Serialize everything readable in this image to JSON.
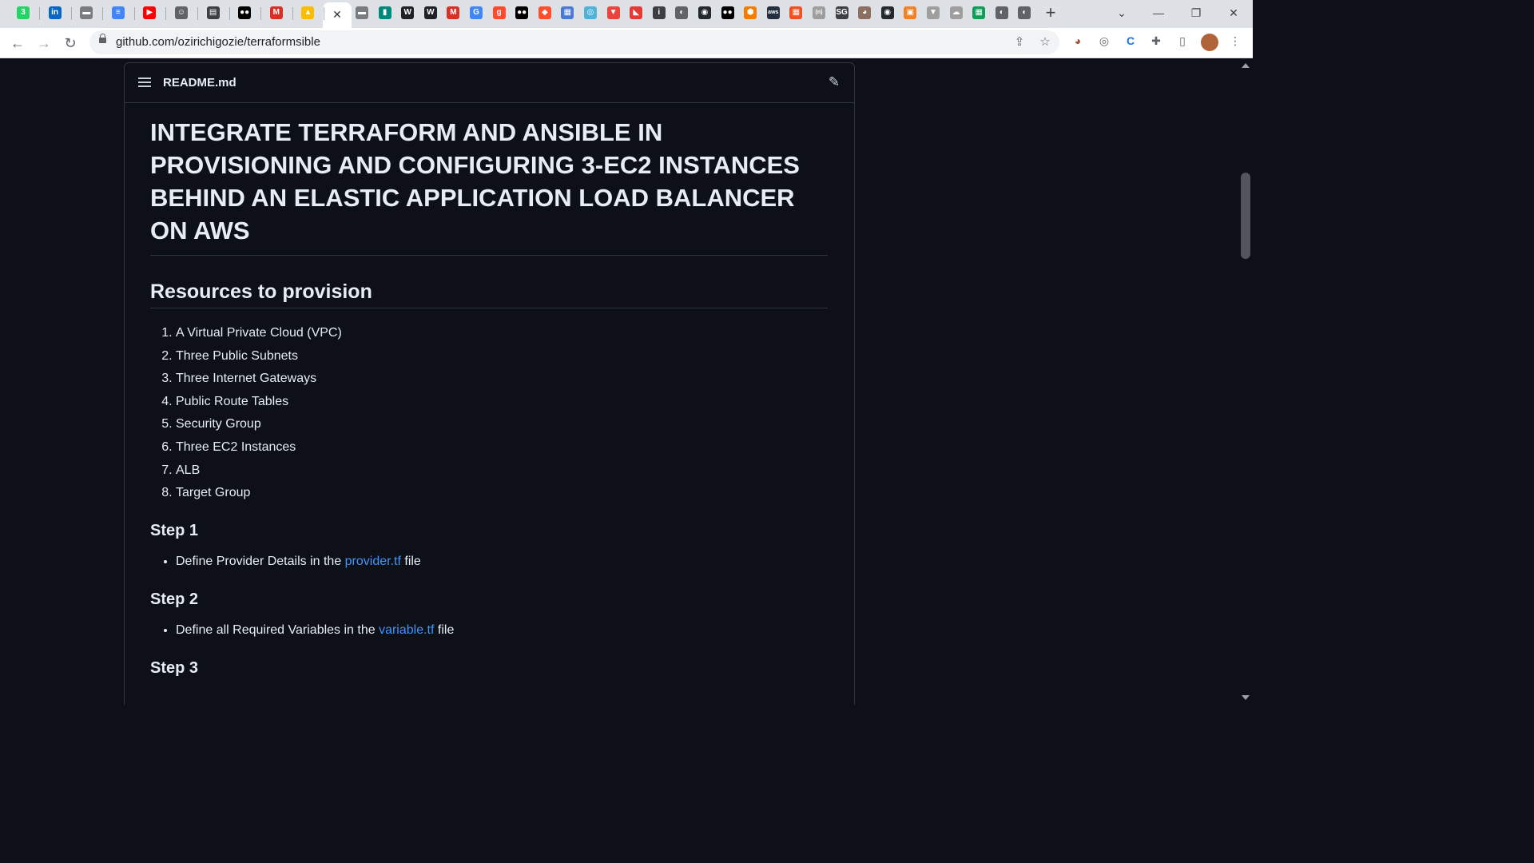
{
  "browser": {
    "tabs": [
      {
        "icon": "whatsapp-icon",
        "glyph": "3",
        "color": "#25d366"
      },
      {
        "icon": "linkedin-icon",
        "glyph": "in",
        "color": "#0a66c2"
      },
      {
        "icon": "folder-icon",
        "glyph": "▬",
        "color": "#7a7d80"
      },
      {
        "icon": "docs-icon",
        "glyph": "≡",
        "color": "#4285f4"
      },
      {
        "icon": "youtube-icon",
        "glyph": "▶",
        "color": "#ff0000"
      },
      {
        "icon": "smiley-icon",
        "glyph": "☺",
        "color": "#5f6368"
      },
      {
        "icon": "film-icon",
        "glyph": "▤",
        "color": "#3c4043"
      },
      {
        "icon": "medium-icon",
        "glyph": "●●",
        "color": "#000000"
      },
      {
        "icon": "gmail-icon",
        "glyph": "M",
        "color": "#d93025"
      },
      {
        "icon": "google-drive-icon",
        "glyph": "▲",
        "color": "#fbbc04"
      },
      {
        "icon": "folder-icon",
        "glyph": "▬",
        "color": "#7a7d80"
      },
      {
        "icon": "meet-icon",
        "glyph": "▮",
        "color": "#00897b"
      },
      {
        "icon": "wikipedia-icon",
        "glyph": "W",
        "color": "#202124"
      },
      {
        "icon": "wikipedia-icon",
        "glyph": "W",
        "color": "#202124"
      },
      {
        "icon": "gmail-icon",
        "glyph": "M",
        "color": "#d93025"
      },
      {
        "icon": "google-icon",
        "glyph": "G",
        "color": "#4285f4"
      },
      {
        "icon": "g2-icon",
        "glyph": "g",
        "color": "#ff492c"
      },
      {
        "icon": "medium-icon",
        "glyph": "●●",
        "color": "#000000"
      },
      {
        "icon": "diamond-icon",
        "glyph": "◆",
        "color": "#ff4f2c"
      },
      {
        "icon": "calendar-icon",
        "glyph": "▦",
        "color": "#4a7bd0"
      },
      {
        "icon": "spiral-icon",
        "glyph": "◎",
        "color": "#4fb3d9"
      },
      {
        "icon": "shield-icon",
        "glyph": "▼",
        "color": "#e8453c"
      },
      {
        "icon": "pdf-icon",
        "glyph": "◣",
        "color": "#e53935"
      },
      {
        "icon": "info-icon",
        "glyph": "i",
        "color": "#3c4043"
      },
      {
        "icon": "globe-icon",
        "glyph": "◐",
        "color": "#5f6368"
      },
      {
        "icon": "github-icon",
        "glyph": "◉",
        "color": "#24292f"
      },
      {
        "icon": "medium-icon",
        "glyph": "●●",
        "color": "#000000"
      },
      {
        "icon": "cube-icon",
        "glyph": "⬢",
        "color": "#f57c00"
      },
      {
        "icon": "aws-icon",
        "glyph": "aws",
        "color": "#232f3e"
      },
      {
        "icon": "microsoft-icon",
        "glyph": "▦",
        "color": "#f25022"
      },
      {
        "icon": "n-icon",
        "glyph": "(n)",
        "color": "#9e9e9e"
      },
      {
        "icon": "sg-icon",
        "glyph": "SG",
        "color": "#3c4043"
      },
      {
        "icon": "avatar-icon",
        "glyph": "◕",
        "color": "#8d6e63"
      },
      {
        "icon": "github-icon",
        "glyph": "◉",
        "color": "#24292f"
      },
      {
        "icon": "stack-icon",
        "glyph": "▣",
        "color": "#f48024"
      },
      {
        "icon": "badge-icon",
        "glyph": "▼",
        "color": "#9e9e9e"
      },
      {
        "icon": "cloud-icon",
        "glyph": "☁",
        "color": "#9e9e9e"
      },
      {
        "icon": "sheets-icon",
        "glyph": "▦",
        "color": "#0f9d58"
      },
      {
        "icon": "globe-icon",
        "glyph": "◐",
        "color": "#5f6368"
      },
      {
        "icon": "globe-icon",
        "glyph": "◐",
        "color": "#5f6368"
      }
    ],
    "active_tab_icon": "✕",
    "new_tab": "+",
    "url": "github.com/ozirichigozie/terraformsible"
  },
  "readme": {
    "filename": "README.md",
    "title": "INTEGRATE TERRAFORM AND ANSIBLE IN PROVISIONING AND CONFIGURING 3-EC2 INSTANCES BEHIND AN ELASTIC APPLICATION LOAD BALANCER ON AWS",
    "resources_heading": "Resources to provision",
    "resources": [
      "A Virtual Private Cloud (VPC)",
      "Three Public Subnets",
      "Three Internet Gateways",
      "Public Route Tables",
      "Security Group",
      "Three EC2 Instances",
      "ALB",
      "Target Group"
    ],
    "step1": {
      "heading": "Step 1",
      "text_before": "Define Provider Details in the ",
      "link": "provider.tf",
      "text_after": " file"
    },
    "step2": {
      "heading": "Step 2",
      "text_before": "Define all Required Variables in the ",
      "link": "variable.tf",
      "text_after": " file"
    },
    "step3": {
      "heading": "Step 3"
    }
  }
}
